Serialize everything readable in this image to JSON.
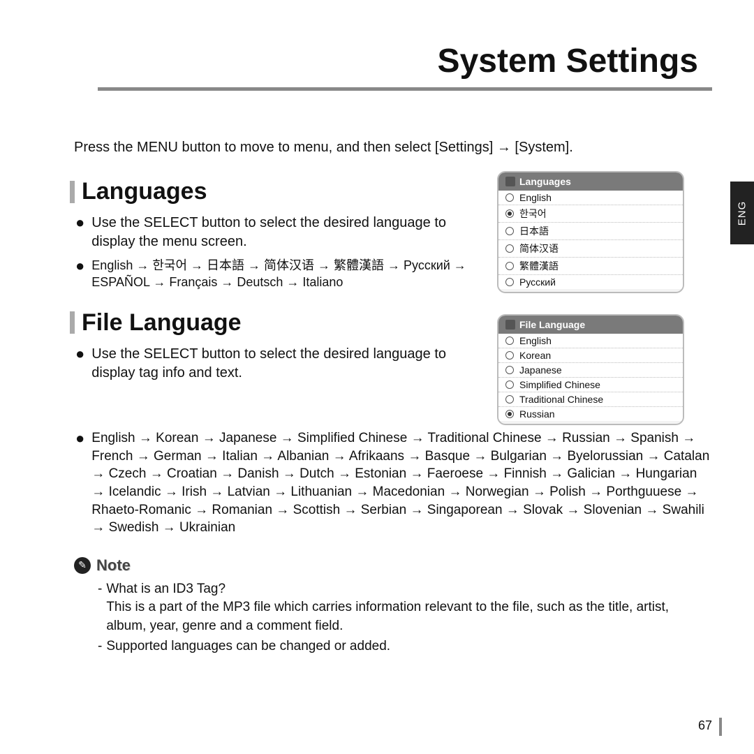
{
  "pageTitle": "System Settings",
  "sideTab": "ENG",
  "intro": "Press the MENU button to move to menu, and then select [Settings] → [System].",
  "sec1": {
    "title": "Languages",
    "b1": "Use the SELECT button to select the desired language to display the menu screen.",
    "b2": "English → 한국어 → 日本語 → 简体汉语 → 繁體漢語 → Русский → ESPAÑOL → Français → Deutsch → Italiano"
  },
  "sec2": {
    "title": "File Language",
    "b1": "Use the SELECT button to select the desired language to display tag info and text.",
    "b2": "English → Korean → Japanese → Simplified Chinese → Traditional Chinese → Russian → Spanish → French → German → Italian → Albanian → Afrikaans → Basque → Bulgarian → Byelorussian → Catalan → Czech → Croatian → Danish → Dutch → Estonian → Faeroese → Finnish → Galician → Hungarian → Icelandic → Irish → Latvian → Lithuanian → Macedonian → Norwegian → Polish → Porthguuese → Rhaeto-Romanic → Romanian → Scottish → Serbian → Singaporean → Slovak → Slovenian → Swahili → Swedish → Ukrainian"
  },
  "dev1": {
    "title": "Languages",
    "items": [
      "English",
      "한국어",
      "日本語",
      "简体汉语",
      "繁體漢語",
      "Русский"
    ],
    "selected": 1
  },
  "dev2": {
    "title": "File Language",
    "items": [
      "English",
      "Korean",
      "Japanese",
      "Simplified Chinese",
      "Traditional Chinese",
      "Russian"
    ],
    "selected": 5
  },
  "note": {
    "title": "Note",
    "n1q": "What is an ID3 Tag?",
    "n1a": "This is a part of the MP3 file which carries information relevant to the file, such as the title, artist, album, year, genre and a comment field.",
    "n2": "Supported languages can be changed or added."
  },
  "pageNumber": "67"
}
